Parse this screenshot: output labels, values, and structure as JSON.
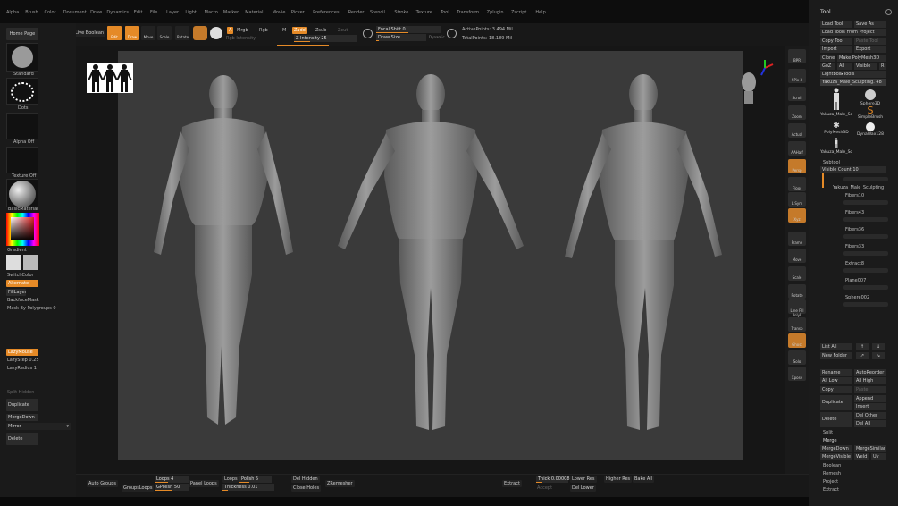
{
  "menu": [
    "Alpha",
    "Brush",
    "Color",
    "Document",
    "Draw",
    "Dynamics",
    "Edit",
    "File",
    "Layer",
    "Light",
    "Macro",
    "Marker",
    "Material",
    "Movie",
    "Picker",
    "Preferences",
    "Render",
    "Stencil",
    "Stroke",
    "Texture",
    "Tool",
    "Transform",
    "Zplugin",
    "Zscript",
    "Help"
  ],
  "top": {
    "live_boolean": "Live Boolean",
    "edit": "Edit",
    "draw": "Draw",
    "move": "Move",
    "scale": "Scale",
    "rotate": "Rotate",
    "a": "A",
    "mrgb": "Mrgb",
    "rgb": "Rgb",
    "m": "M",
    "rgb_intensity": "Rgb Intensity",
    "zadd": "Zadd",
    "zsub": "Zsub",
    "zcut": "Zcut",
    "z_intensity": "Z Intensity 25",
    "focal_shift": "Focal Shift 0",
    "draw_size": "Draw Size",
    "dynamic": "Dynamic",
    "active_points": "ActivePoints: 3.494 Mil",
    "total_points": "TotalPoints: 18.189 Mil"
  },
  "left": {
    "home_page": "Home Page",
    "standard": "Standard",
    "dots": "Dots",
    "alpha_off": "Alpha Off",
    "texture_off": "Texture Off",
    "basic_material": "BasicMaterial",
    "gradient": "Gradient",
    "switch_color": "SwitchColor",
    "alternate": "Alternate",
    "fill_layer": "FillLayer",
    "backface_mask": "BackfaceMask",
    "mask_by_polygroups": "Mask By Polygroups 0",
    "lazy_mouse": "LazyMouse",
    "lazy_step": "LazyStep 0.25",
    "lazy_radius": "LazyRadius 1",
    "split_hidden": "Split Hidden",
    "duplicate": "Duplicate",
    "merge_down": "MergeDown",
    "mirror": "Mirror",
    "delete": "Delete"
  },
  "shelf": [
    "BPR",
    "SPix 3",
    "Scroll",
    "Zoom",
    "Actual",
    "AAHalf",
    "Persp",
    "Floor",
    "L.Sym",
    "Xyz",
    "Frame",
    "Move",
    "Scale",
    "Rotate",
    "Line Fill PolyF",
    "Transp",
    "Ghost",
    "Solo",
    "Xpose"
  ],
  "tool_panel": {
    "title": "Tool",
    "load_tool": "Load Tool",
    "save_as": "Save As",
    "load_tools_from_project": "Load Tools From Project",
    "copy_tool": "Copy Tool",
    "paste_tool": "Paste Tool",
    "import": "Import",
    "export": "Export",
    "clone": "Clone",
    "make_polymesh3d": "Make PolyMesh3D",
    "goz": "GoZ",
    "all": "All",
    "visible": "Visible",
    "r": "R",
    "lightbox_tools": "Lightbox▸Tools",
    "current_tool": "Yakuza_Male_Sculpting. 48",
    "thumbs": [
      "Yakuza_Male_Sc",
      "Sphere3D",
      "SimpleBrush",
      "PolyMesh3D",
      "DynaWax128",
      "Yakuza_Male_Sc"
    ],
    "subtool": "Subtool",
    "visible_count": "Visible Count 10",
    "subtools": [
      "Yakuza_Male_Sculpting",
      "Fibers10",
      "Fibers43",
      "Fibers36",
      "Fibers33",
      "Extract8",
      "Plane007",
      "Sphere002"
    ],
    "list_all": "List All",
    "new_folder": "New Folder",
    "rename": "Rename",
    "auto_reorder": "AutoReorder",
    "all_low": "All Low",
    "all_high": "All High",
    "copy": "Copy",
    "paste": "Paste",
    "duplicate": "Duplicate",
    "append": "Append",
    "insert": "Insert",
    "delete": "Delete",
    "del_other": "Del Other",
    "del_all": "Del All",
    "split": "Split",
    "merge": "Merge",
    "merge_down": "MergeDown",
    "merge_similar": "MergeSimilar",
    "merge_visible": "MergeVisible",
    "weld": "Weld",
    "uv": "Uv",
    "boolean": "Boolean",
    "remesh": "Remesh",
    "project": "Project",
    "extract": "Extract"
  },
  "bottom": {
    "auto_groups": "Auto Groups",
    "groups_loops": "GroupsLoops",
    "loops_4": "Loops 4",
    "gpolish": "GPolish 50",
    "panel_loops": "Panel Loops",
    "loops": "Loops",
    "polish": "Polish 5",
    "thickness": "Thickness 0.01",
    "del_hidden": "Del Hidden",
    "close_holes": "Close Holes",
    "zremesher": "ZRemesher",
    "extract": "Extract",
    "thick": "Thick 0.00008",
    "accept": "Accept",
    "lower_res": "Lower Res",
    "higher_res": "Higher Res",
    "del_lower": "Del Lower",
    "bake_all": "Bake All"
  },
  "colors": {
    "accent": "#e58a27",
    "viewport": "#3a3a3a",
    "panel": "#1b1b1b"
  }
}
